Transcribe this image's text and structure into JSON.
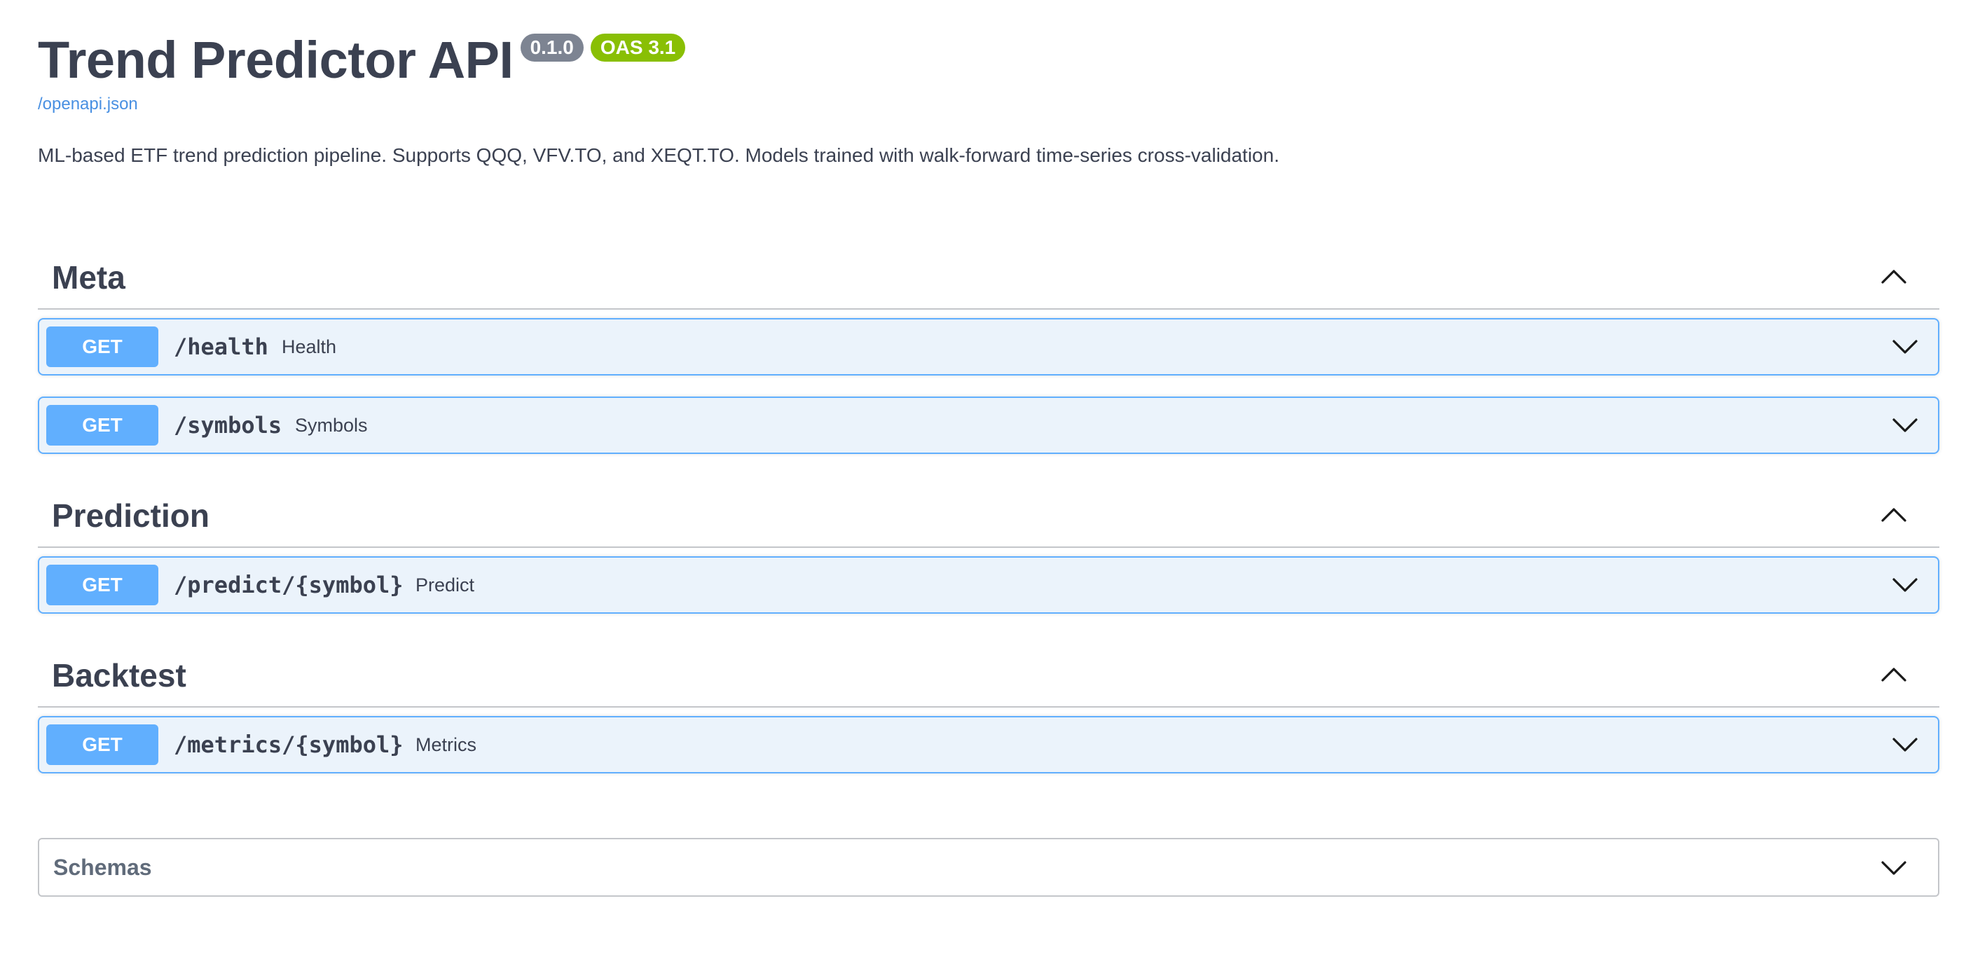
{
  "header": {
    "title": "Trend Predictor API",
    "version_badge": "0.1.0",
    "oas_badge": "OAS 3.1",
    "spec_link": "/openapi.json",
    "description": "ML-based ETF trend prediction pipeline. Supports QQQ, VFV.TO, and XEQT.TO. Models trained with walk-forward time-series cross-validation."
  },
  "tags": [
    {
      "name": "Meta",
      "expanded": true,
      "operations": [
        {
          "method": "GET",
          "path": "/health",
          "summary": "Health"
        },
        {
          "method": "GET",
          "path": "/symbols",
          "summary": "Symbols"
        }
      ]
    },
    {
      "name": "Prediction",
      "expanded": true,
      "operations": [
        {
          "method": "GET",
          "path": "/predict/{symbol}",
          "summary": "Predict"
        }
      ]
    },
    {
      "name": "Backtest",
      "expanded": true,
      "operations": [
        {
          "method": "GET",
          "path": "/metrics/{symbol}",
          "summary": "Metrics"
        }
      ]
    }
  ],
  "schemas": {
    "label": "Schemas",
    "expanded": false
  },
  "colors": {
    "get_method": "#61affe",
    "get_background": "#ebf3fb",
    "version_badge": "#7d8492",
    "oas_badge": "#89bf04",
    "link": "#4990e2",
    "text": "#3b4151"
  },
  "icons": {
    "tag_toggle": "chevron-up-icon",
    "operation_toggle": "chevron-down-icon",
    "schemas_toggle": "chevron-down-icon"
  }
}
